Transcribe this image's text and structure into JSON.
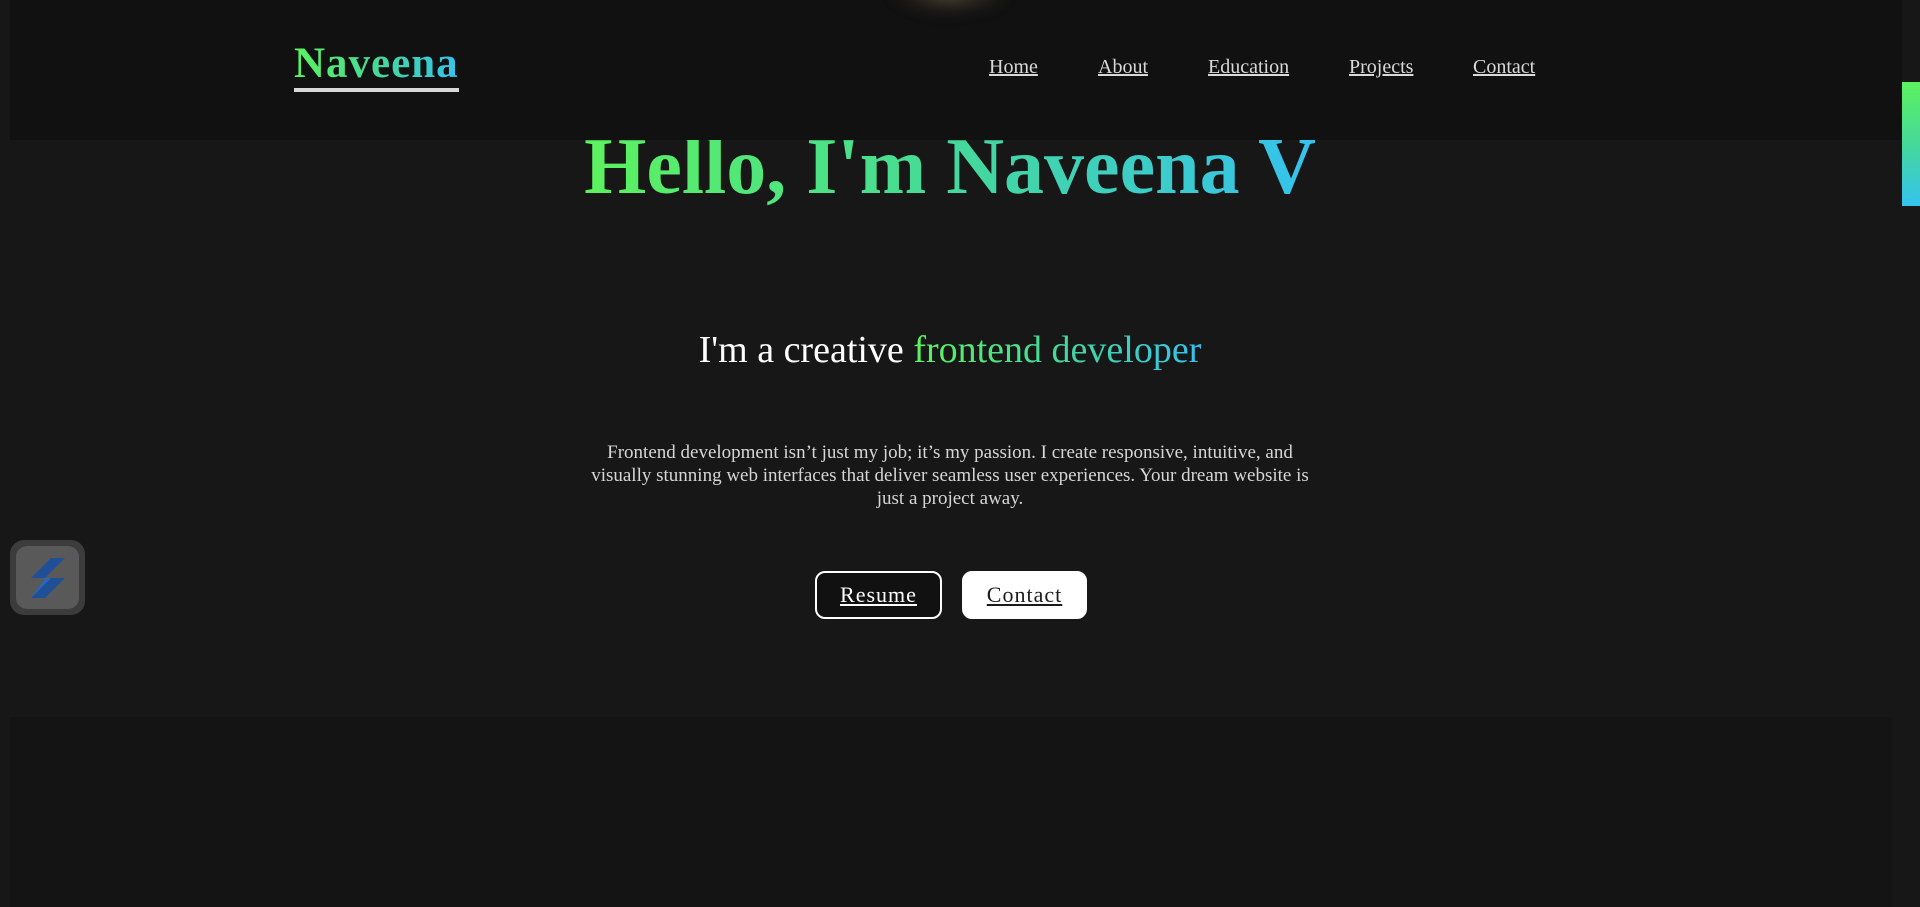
{
  "brand": {
    "logo_text": "Naveena"
  },
  "nav": {
    "items": [
      {
        "label": "Home"
      },
      {
        "label": "About"
      },
      {
        "label": "Education"
      },
      {
        "label": "Projects"
      },
      {
        "label": "Contact"
      }
    ]
  },
  "hero": {
    "title": "Hello, I'm Naveena V",
    "subtitle_prefix": "I'm a creative ",
    "subtitle_highlight": "frontend developer",
    "description": "Frontend development isn’t just my job; it’s my passion. I create responsive, intuitive, and visually stunning web interfaces that deliver seamless user experiences. Your dream website is just a project away.",
    "buttons": {
      "resume_label": "Resume",
      "contact_label": "Contact"
    }
  },
  "widget": {
    "icon": "stacked-s-logo-icon"
  },
  "colors": {
    "background": "#171717",
    "navbar": "#111111",
    "gradient_start": "#5cf25e",
    "gradient_mid": "#45d99a",
    "gradient_end": "#35c2ef",
    "text_primary": "#ffffff",
    "text_secondary": "#d6d6d6"
  }
}
